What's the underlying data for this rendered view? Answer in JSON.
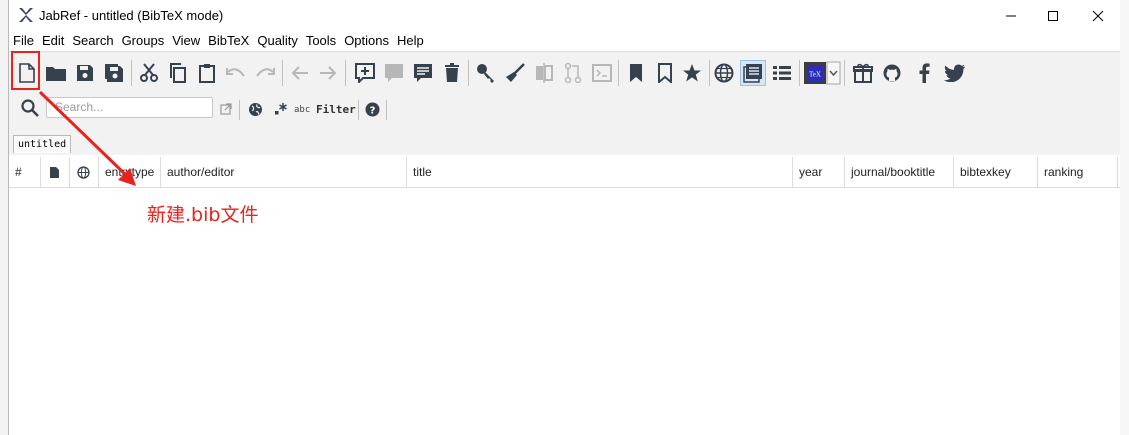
{
  "window": {
    "title": "JabRef - untitled (BibTeX mode)"
  },
  "menu": [
    "File",
    "Edit",
    "Search",
    "Groups",
    "View",
    "BibTeX",
    "Quality",
    "Tools",
    "Options",
    "Help"
  ],
  "search": {
    "placeholder": "Search..."
  },
  "filter": {
    "abc_label": "abc",
    "label": "Filter"
  },
  "tabs": [
    {
      "label": "untitled"
    }
  ],
  "table": {
    "columns": [
      "#",
      "",
      "",
      "entrytype",
      "author/editor",
      "title",
      "year",
      "journal/booktitle",
      "bibtexkey",
      "ranking"
    ]
  },
  "annotation": {
    "text": "新建.bib文件",
    "color": "#e8231d"
  },
  "colors": {
    "icon": "#36414e",
    "accent": "#2a5db0"
  }
}
